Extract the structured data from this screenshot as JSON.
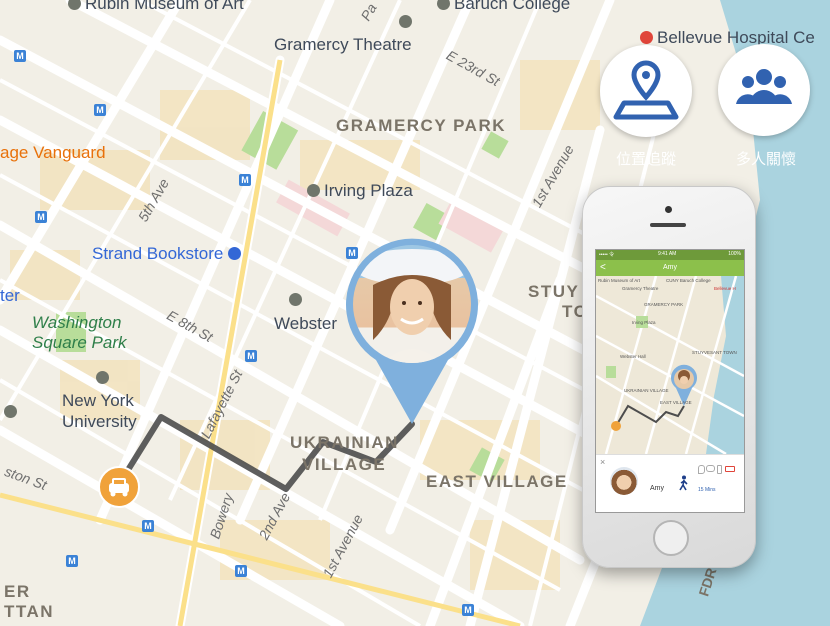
{
  "map": {
    "pois": {
      "rubin_museum": "Rubin Museum of Art",
      "baruch_college": "Baruch College",
      "gramercy_theatre": "Gramercy Theatre",
      "bellevue_hospital": "Bellevue Hospital Ce",
      "village_vanguard": "age Vanguard",
      "irving_plaza": "Irving Plaza",
      "strand_bookstore": "Strand Bookstore",
      "washington_square_park_1": "Washington",
      "washington_square_park_2": "Square Park",
      "webster_hall": "Webster",
      "new_york_university_1": "New York",
      "new_york_university_2": "University",
      "ter": "ter"
    },
    "districts": {
      "gramercy_park": "GRAMERCY PARK",
      "ukrainian_village_1": "UKRAINIAN",
      "ukrainian_village_2": "VILLAGE",
      "east_village": "EAST VILLAGE",
      "stuy_1": "STUY",
      "stuy_2": "TO",
      "er": "ER",
      "ttan": "TTAN"
    },
    "streets": {
      "e_23rd": "E 23rd St",
      "first_ave_top": "1st Avenue",
      "fifth_ave": "5th Ave",
      "e_8th": "E 8th St",
      "lafayette": "Lafayette St",
      "bowery": "Bowery",
      "second_ave": "2nd Ave",
      "first_ave_bottom": "1st Avenue",
      "ston": "ston St",
      "fdr": "FDR",
      "park": "Pa"
    }
  },
  "actions": {
    "location_label": "位置追蹤",
    "group_label": "多人關懷"
  },
  "phone": {
    "status_left": "••••• 令",
    "status_time": "9:41 AM",
    "status_right": "100%",
    "nav_title": "Amy",
    "back_glyph": "<",
    "mini_labels": {
      "rubin": "Rubin Museum of Art",
      "gramercy_theatre": "Gramercy Theatre",
      "baruch": "CUNY Baruch College",
      "bellevue": "Bellevue H",
      "gramercy_park": "GRAMERCY PARK",
      "irving": "Irving Plaza",
      "webster": "Webster Hall",
      "stuy": "STUYVESANT TOWN",
      "ukrainian": "UKRAINIAN VILLAGE",
      "east_village": "EAST VILLAGE"
    },
    "bottom": {
      "name": "Amy",
      "eta": "15 Mins",
      "close_glyph": "×"
    }
  },
  "colors": {
    "route": "#4d4d4d",
    "pin": "#7fb0dd",
    "taxi": "#f0a23a",
    "action_icon": "#3162b0",
    "phone_header": "#8cc04b",
    "water": "#aad3df",
    "park": "#b8dd9a"
  },
  "icons": {
    "location_button": "map-pin-icon",
    "group_button": "group-people-icon",
    "start_marker": "taxi-icon",
    "walk": "walking-person-icon"
  }
}
